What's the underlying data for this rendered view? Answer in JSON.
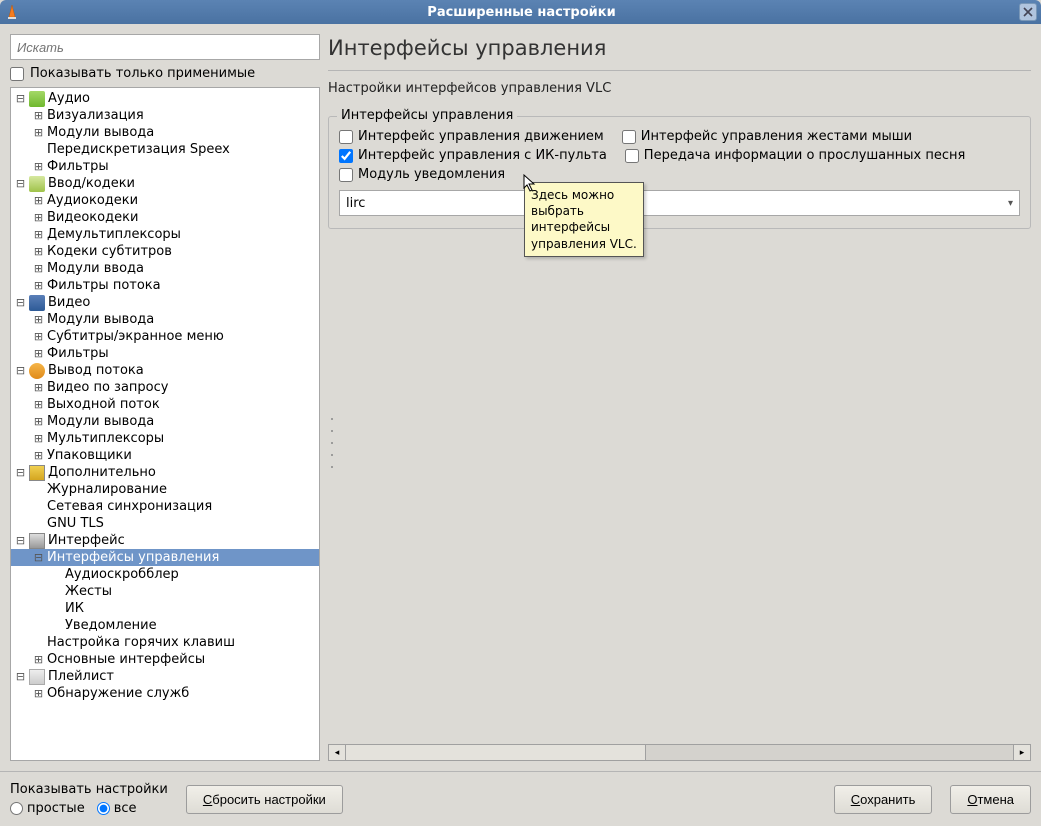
{
  "titlebar": {
    "title": "Расширенные настройки"
  },
  "search": {
    "placeholder": "Искать"
  },
  "show_applicable_label": "Показывать только применимые",
  "tree": [
    {
      "depth": 0,
      "exp": "−",
      "icon": "audio",
      "label": "Аудио"
    },
    {
      "depth": 1,
      "exp": "+",
      "label": "Визуализация"
    },
    {
      "depth": 1,
      "exp": "+",
      "label": "Модули вывода"
    },
    {
      "depth": 1,
      "exp": "",
      "label": "Передискретизация Speex"
    },
    {
      "depth": 1,
      "exp": "+",
      "label": "Фильтры"
    },
    {
      "depth": 0,
      "exp": "−",
      "icon": "input",
      "label": "Ввод/кодеки"
    },
    {
      "depth": 1,
      "exp": "+",
      "label": "Аудиокодеки"
    },
    {
      "depth": 1,
      "exp": "+",
      "label": "Видеокодеки"
    },
    {
      "depth": 1,
      "exp": "+",
      "label": "Демультиплексоры"
    },
    {
      "depth": 1,
      "exp": "+",
      "label": "Кодеки субтитров"
    },
    {
      "depth": 1,
      "exp": "+",
      "label": "Модули ввода"
    },
    {
      "depth": 1,
      "exp": "+",
      "label": "Фильтры потока"
    },
    {
      "depth": 0,
      "exp": "−",
      "icon": "video",
      "label": "Видео"
    },
    {
      "depth": 1,
      "exp": "+",
      "label": "Модули вывода"
    },
    {
      "depth": 1,
      "exp": "+",
      "label": "Субтитры/экранное меню"
    },
    {
      "depth": 1,
      "exp": "+",
      "label": "Фильтры"
    },
    {
      "depth": 0,
      "exp": "−",
      "icon": "stream",
      "label": "Вывод потока"
    },
    {
      "depth": 1,
      "exp": "+",
      "label": "Видео по запросу"
    },
    {
      "depth": 1,
      "exp": "+",
      "label": "Выходной поток"
    },
    {
      "depth": 1,
      "exp": "+",
      "label": "Модули вывода"
    },
    {
      "depth": 1,
      "exp": "+",
      "label": "Мультиплексоры"
    },
    {
      "depth": 1,
      "exp": "+",
      "label": "Упаковщики"
    },
    {
      "depth": 0,
      "exp": "−",
      "icon": "extra",
      "label": "Дополнительно"
    },
    {
      "depth": 1,
      "exp": "",
      "label": "Журналирование"
    },
    {
      "depth": 1,
      "exp": "",
      "label": "Сетевая синхронизация"
    },
    {
      "depth": 1,
      "exp": "",
      "label": "GNU TLS"
    },
    {
      "depth": 0,
      "exp": "−",
      "icon": "iface",
      "label": "Интерфейс"
    },
    {
      "depth": 1,
      "exp": "−",
      "label": "Интерфейсы управления",
      "selected": true
    },
    {
      "depth": 2,
      "exp": "",
      "label": "Аудиоскробблер"
    },
    {
      "depth": 2,
      "exp": "",
      "label": "Жесты"
    },
    {
      "depth": 2,
      "exp": "",
      "label": "ИК"
    },
    {
      "depth": 2,
      "exp": "",
      "label": "Уведомление"
    },
    {
      "depth": 1,
      "exp": "",
      "label": "Настройка горячих клавиш"
    },
    {
      "depth": 1,
      "exp": "+",
      "label": "Основные интерфейсы"
    },
    {
      "depth": 0,
      "exp": "−",
      "icon": "playlist",
      "label": "Плейлист"
    },
    {
      "depth": 1,
      "exp": "+",
      "label": "Обнаружение служб"
    }
  ],
  "main": {
    "title": "Интерфейсы управления",
    "subtitle": "Настройки интерфейсов управления VLC",
    "fieldset_legend": "Интерфейсы управления",
    "checkboxes": [
      {
        "label": "Интерфейс управления движением",
        "checked": false
      },
      {
        "label": "Интерфейс управления жестами мыши",
        "checked": false
      },
      {
        "label": "Интерфейс управления с ИК-пульта",
        "checked": true
      },
      {
        "label": "Передача информации о прослушанных песня",
        "checked": false
      },
      {
        "label": "Модуль уведомления",
        "checked": false
      }
    ],
    "dropdown_value": "lirc",
    "tooltip": "Здесь можно\nвыбрать\nинтерфейсы\nуправления VLC."
  },
  "footer": {
    "show_settings_label": "Показывать настройки",
    "radio_simple": "простые",
    "radio_all": "все",
    "reset": "Сбросить настройки",
    "save": "Сохранить",
    "cancel": "Отмена"
  }
}
